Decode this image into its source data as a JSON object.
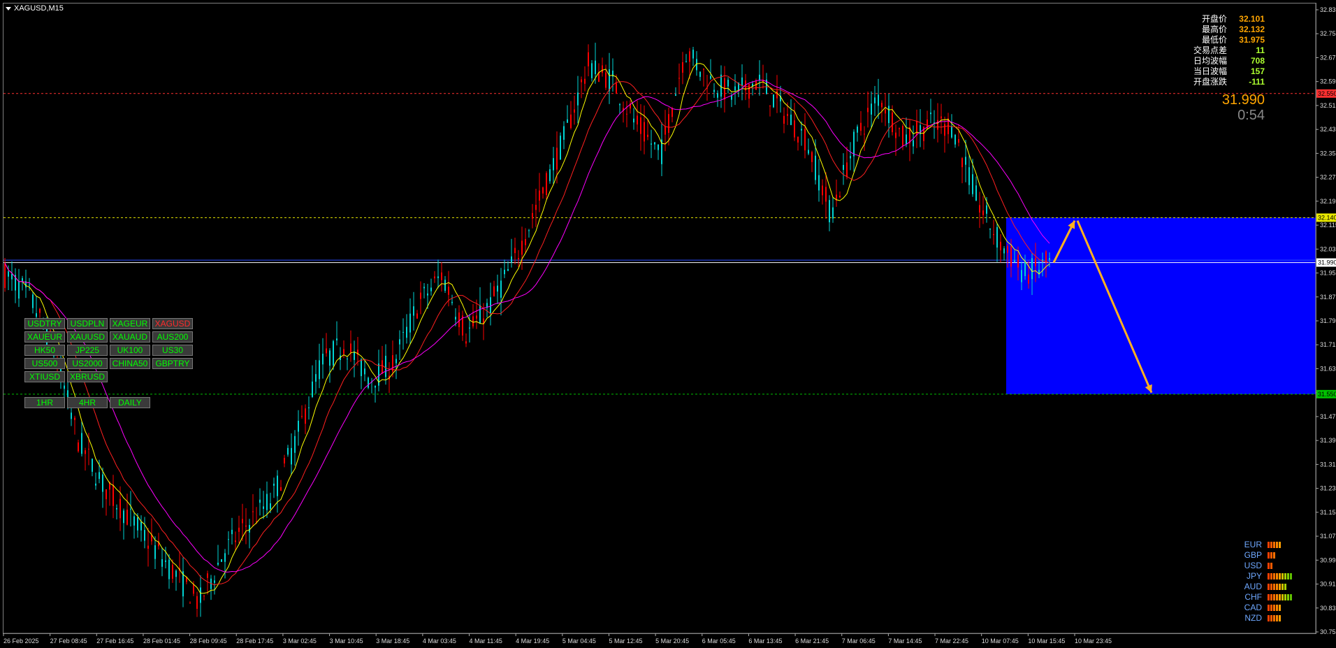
{
  "window": {
    "title": "XAGUSD,M15"
  },
  "colors": {
    "bg": "#000000",
    "bull": "#ff0000",
    "bear": "#00d4d4",
    "ma_fast": "#ffff00",
    "ma_mid": "#ff2020",
    "ma_slow": "#ff00ff",
    "zone": "#0000ff",
    "arrow": "#ffb020"
  },
  "stats": [
    {
      "label": "开盘价",
      "value": "32.101",
      "color": "#ffa500"
    },
    {
      "label": "最高价",
      "value": "32.132",
      "color": "#ffa500"
    },
    {
      "label": "最低价",
      "value": "31.975",
      "color": "#ffa500"
    },
    {
      "label": "交易点差",
      "value": "11",
      "color": "#adff2f"
    },
    {
      "label": "日均波幅",
      "value": "708",
      "color": "#adff2f"
    },
    {
      "label": "当日波幅",
      "value": "157",
      "color": "#adff2f"
    },
    {
      "label": "开盘涨跌",
      "value": "-111",
      "color": "#adff2f"
    }
  ],
  "price": {
    "current": "31.990",
    "timer": "0:54"
  },
  "symbols": [
    "USDTRY",
    "USDPLN",
    "XAGEUR",
    "XAGUSD",
    "XAUEUR",
    "XAUUSD",
    "XAUAUD",
    "AUS200",
    "HK50",
    "JP225",
    "UK100",
    "US30",
    "US500",
    "US2000",
    "CHINA50",
    "GBPTRY",
    "XTIUSD",
    "XBRUSD"
  ],
  "active_symbol": "XAGUSD",
  "timeframes": [
    "1HR",
    "4HR",
    "DAILY"
  ],
  "strength": [
    {
      "currency": "EUR",
      "level": 5
    },
    {
      "currency": "GBP",
      "level": 3
    },
    {
      "currency": "USD",
      "level": 2
    },
    {
      "currency": "JPY",
      "level": 9
    },
    {
      "currency": "AUD",
      "level": 7
    },
    {
      "currency": "CHF",
      "level": 9
    },
    {
      "currency": "CAD",
      "level": 5
    },
    {
      "currency": "NZD",
      "level": 5
    }
  ],
  "chart_data": {
    "type": "candlestick",
    "symbol": "XAGUSD",
    "timeframe": "M15",
    "ylim": [
      30.755,
      32.835
    ],
    "y_ticks": [
      "32.835",
      "32.755",
      "32.675",
      "32.595",
      "32.515",
      "32.435",
      "32.355",
      "32.275",
      "32.195",
      "32.115",
      "32.035",
      "31.955",
      "31.875",
      "31.795",
      "31.715",
      "31.635",
      "31.555",
      "31.475",
      "31.395",
      "31.315",
      "31.235",
      "31.155",
      "31.075",
      "30.995",
      "30.915",
      "30.835",
      "30.755"
    ],
    "x_ticks": [
      "26 Feb 2025",
      "27 Feb 08:45",
      "27 Feb 16:45",
      "28 Feb 01:45",
      "28 Feb 09:45",
      "28 Feb 17:45",
      "3 Mar 02:45",
      "3 Mar 10:45",
      "3 Mar 18:45",
      "4 Mar 03:45",
      "4 Mar 11:45",
      "4 Mar 19:45",
      "5 Mar 04:45",
      "5 Mar 12:45",
      "5 Mar 20:45",
      "6 Mar 05:45",
      "6 Mar 13:45",
      "6 Mar 21:45",
      "7 Mar 06:45",
      "7 Mar 14:45",
      "7 Mar 22:45",
      "10 Mar 07:45",
      "10 Mar 15:45",
      "10 Mar 23:45"
    ],
    "price_path": [
      31.95,
      31.88,
      31.7,
      31.4,
      31.25,
      31.15,
      31.05,
      30.95,
      30.85,
      31.02,
      31.12,
      31.2,
      31.4,
      31.65,
      31.72,
      31.6,
      31.65,
      31.85,
      31.95,
      31.75,
      31.85,
      32.0,
      32.2,
      32.4,
      32.65,
      32.6,
      32.45,
      32.35,
      32.7,
      32.6,
      32.55,
      32.6,
      32.5,
      32.4,
      32.15,
      32.4,
      32.55,
      32.4,
      32.45,
      32.45,
      32.2,
      32.05,
      31.95,
      31.99
    ],
    "h_levels": [
      {
        "price": 32.555,
        "label": "32.550",
        "color": "#ff3030"
      },
      {
        "price": 32.14,
        "label": "32.140",
        "color": "#e8e800"
      },
      {
        "price": 31.55,
        "label": "31.550",
        "color": "#00c000"
      },
      {
        "price": 31.99,
        "label": "31.990",
        "color": "#ffffff"
      }
    ],
    "zone": {
      "top": 32.14,
      "bottom": 31.55
    },
    "arrows": [
      {
        "from": 31.99,
        "to": 32.13
      },
      {
        "from": 32.13,
        "to": 31.555
      }
    ]
  }
}
